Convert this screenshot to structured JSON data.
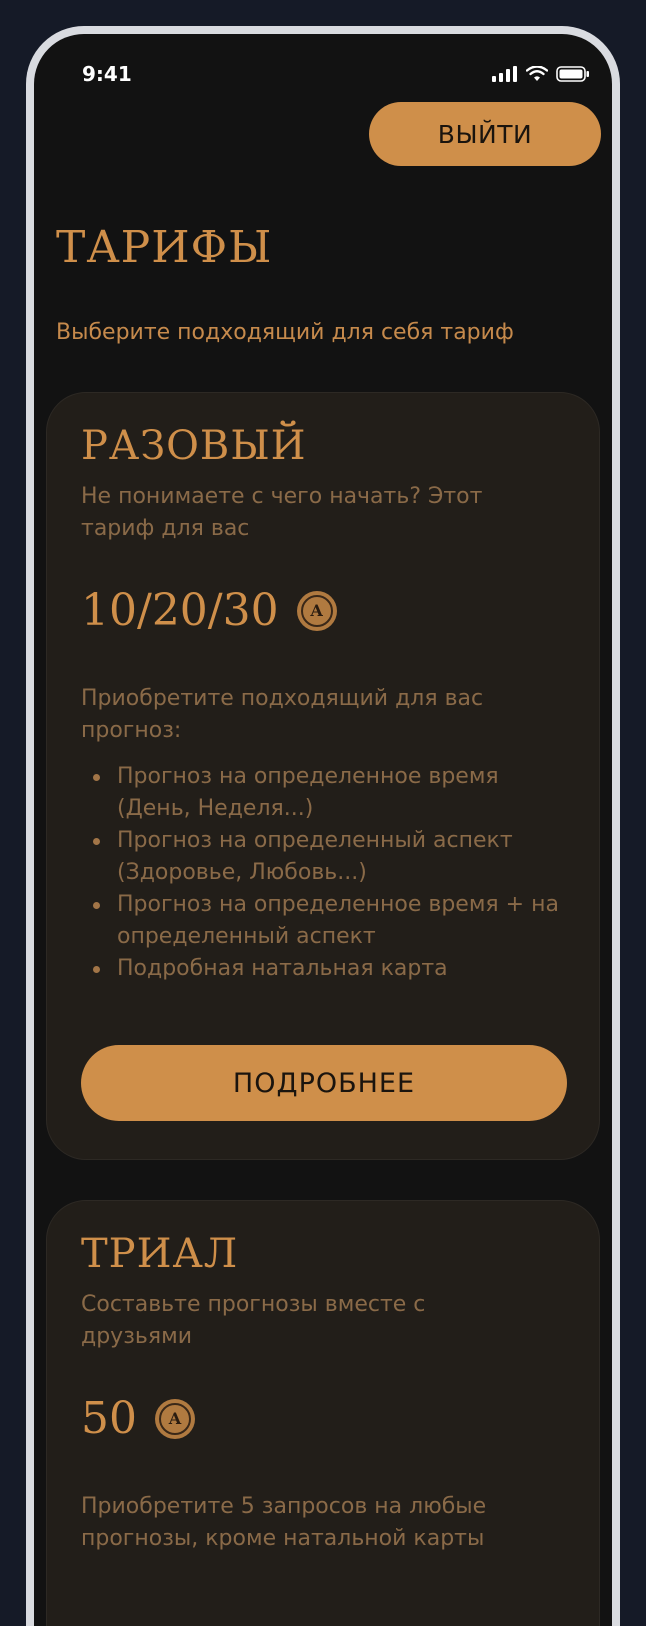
{
  "status_bar": {
    "time": "9:41"
  },
  "header": {
    "logout_label": "ВЫЙТИ"
  },
  "page": {
    "title": "ТАРИФЫ",
    "subtitle": "Выберите подходящий для себя тариф"
  },
  "tariffs": [
    {
      "title": "РАЗОВЫЙ",
      "description": "Не понимаете с чего начать? Этот тариф для вас",
      "price": "10/20/30",
      "currency_icon": "coin-icon",
      "currency_letter": "А",
      "buy_text": "Приобретите подходящий для вас прогноз:",
      "features": [
        "Прогноз на определенное время (День, Неделя...)",
        "Прогноз на определенный аспект (Здоровье, Любовь...)",
        "Прогноз на определенное время + на определенный аспект",
        "Подробная натальная карта"
      ],
      "button_label": "ПОДРОБНЕЕ"
    },
    {
      "title": "ТРИАЛ",
      "description": "Составьте прогнозы вместе с друзьями",
      "price": "50",
      "currency_icon": "coin-icon",
      "currency_letter": "А",
      "buy_text": "Приобретите 5 запросов на любые прогнозы, кроме натальной карты"
    }
  ],
  "colors": {
    "accent": "#cf8f4a",
    "card_bg": "#221e19",
    "screen_bg": "#121212",
    "muted_text": "#8a6a48"
  }
}
